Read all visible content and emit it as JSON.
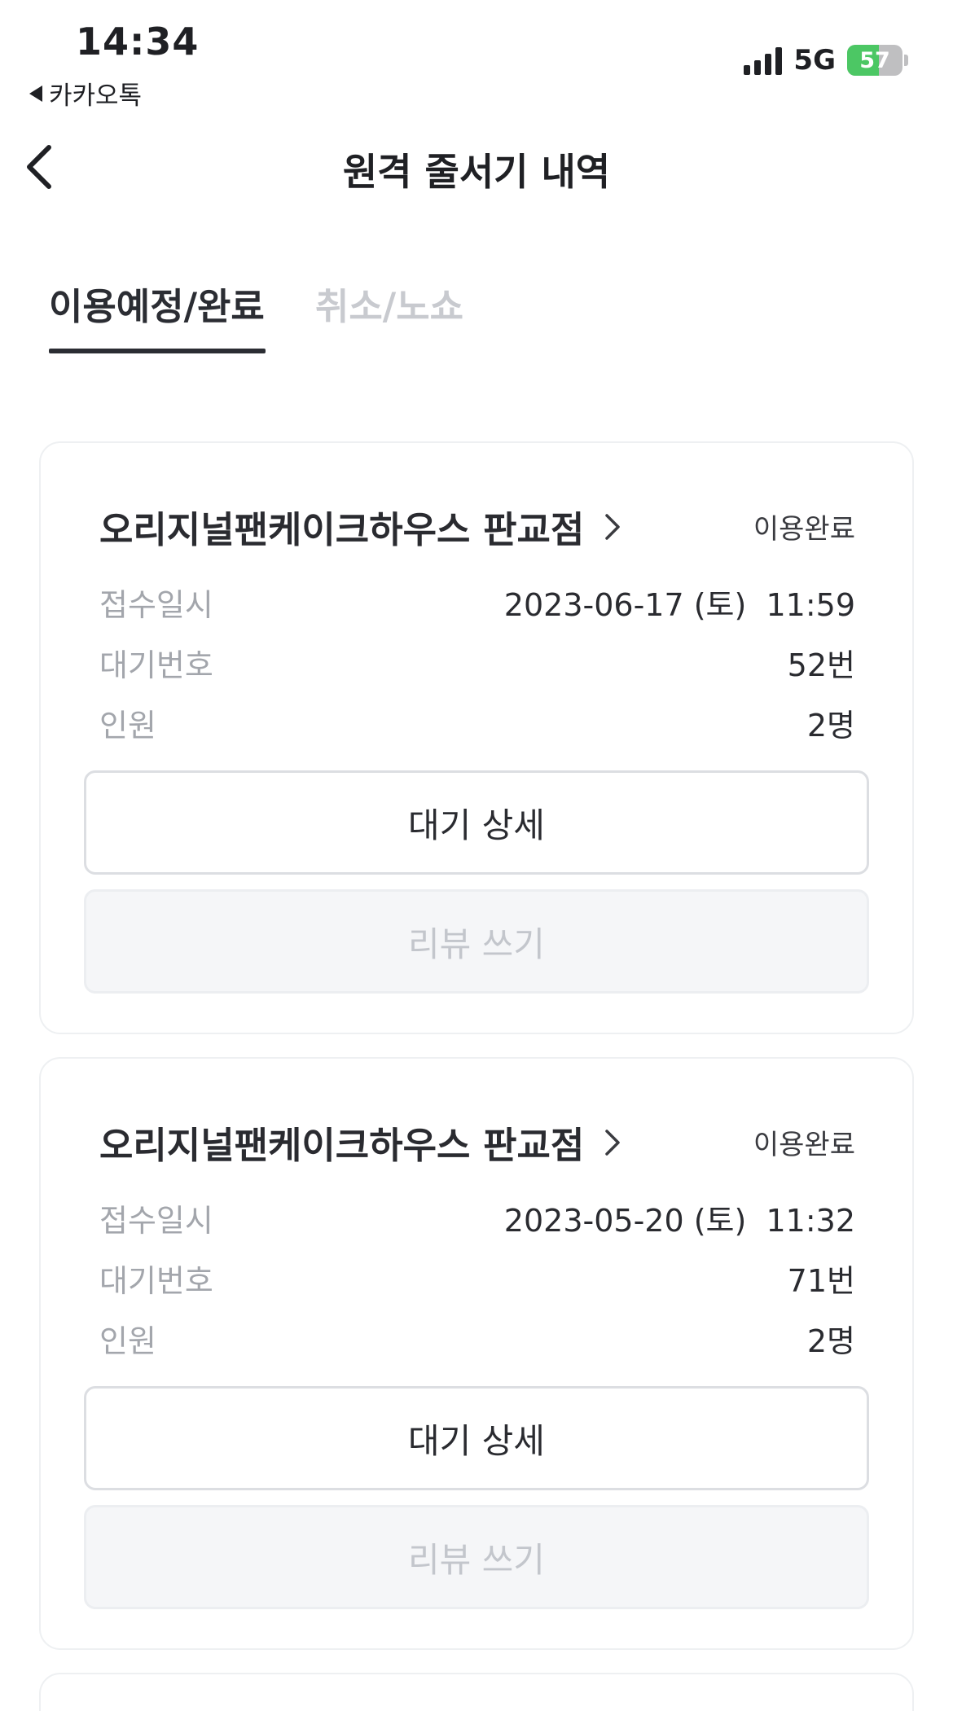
{
  "status_bar": {
    "time": "14:34",
    "back_app": "카카오톡",
    "network": "5G",
    "battery": "57",
    "battery_level": 0.57,
    "battery_color": "#4cc764"
  },
  "header": {
    "title": "원격 줄서기 내역",
    "back_icon": "chevron-left-icon"
  },
  "tabs": [
    {
      "label": "이용예정/완료",
      "active": true
    },
    {
      "label": "취소/노쇼",
      "active": false
    }
  ],
  "labels": {
    "received_at": "접수일시",
    "wait_number": "대기번호",
    "party_size": "인원"
  },
  "cards": [
    {
      "store": "오리지널팬케이크하우스 판교점",
      "status": "이용완료",
      "received_at": "2023-06-17 (토)  11:59",
      "wait_number": "52번",
      "party_size": "2명",
      "detail_button": "대기 상세",
      "review_button": "리뷰 쓰기"
    },
    {
      "store": "오리지널팬케이크하우스 판교점",
      "status": "이용완료",
      "received_at": "2023-05-20 (토)  11:32",
      "wait_number": "71번",
      "party_size": "2명",
      "detail_button": "대기 상세",
      "review_button": "리뷰 쓰기"
    }
  ]
}
